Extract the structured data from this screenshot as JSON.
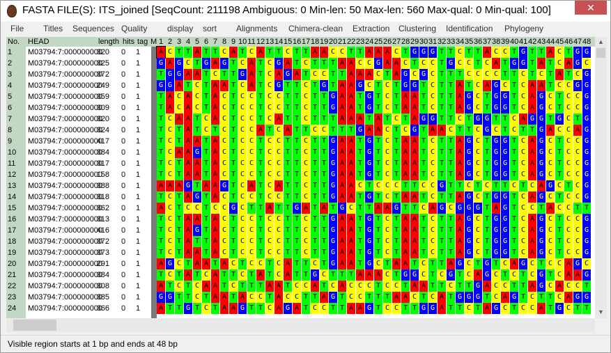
{
  "window": {
    "title": "FASTA FILE(S): ITS_joined [SeqCount: 211198 Ambiguous: 0 Min-len: 50 Max-len: 560 Max-qual: 0 Min-qual: 100]"
  },
  "menu": [
    "File",
    "Titles",
    "Sequences",
    "Quality",
    "display",
    "sort",
    "Alignments",
    "Chimera-clean",
    "Extraction",
    "Clustering",
    "Identification",
    "Phylogeny"
  ],
  "columns": {
    "no": "No.",
    "head": "HEAD",
    "length": "length",
    "hits": "hits",
    "tag": "tag",
    "m": "M"
  },
  "positions": [
    "1",
    "2",
    "3",
    "4",
    "5",
    "6",
    "7",
    "8",
    "9",
    "10",
    "11",
    "12",
    "13",
    "14",
    "15",
    "16",
    "17",
    "18",
    "19",
    "20",
    "21",
    "22",
    "23",
    "24",
    "25",
    "26",
    "27",
    "28",
    "29",
    "30",
    "31",
    "32",
    "33",
    "34",
    "35",
    "36",
    "37",
    "38",
    "39",
    "40",
    "41",
    "42",
    "43",
    "44",
    "45",
    "46",
    "47",
    "48"
  ],
  "rows": [
    {
      "no": "1",
      "head": "M03794:7:000000000",
      "length": "320",
      "hits": "0",
      "tag": "1",
      "seq": "ACTTATTCATCATTCTTAACCTTAAACTGGGTTCTTACCTGTTACTGG"
    },
    {
      "no": "2",
      "head": "M03794:7:000000000",
      "length": "325",
      "hits": "0",
      "tag": "1",
      "seq": "GAGCTGAGTCATCGATCTTTAACCGAACTCCTGCCTCATGGTATCAGC"
    },
    {
      "no": "3",
      "head": "M03794:7:000000000",
      "length": "372",
      "hits": "0",
      "tag": "1",
      "seq": "TGGAATCTTGATCAGATCCTTAAACTAGCGCTTTCCCCTTCTCTATCG"
    },
    {
      "no": "4",
      "head": "M03794:7:000000000",
      "length": "249",
      "hits": "0",
      "tag": "1",
      "seq": "GGATCTAATCATCGTTCTGTAAGCTCTGGTCTTATCAGCTCAATCCGG"
    },
    {
      "no": "5",
      "head": "M03794:7:000000000",
      "length": "359",
      "hits": "0",
      "tag": "1",
      "seq": "TACACTACTCCTCCTTCTTGAATGTCTAATCTTAGCTGGTCAGCTCCG"
    },
    {
      "no": "6",
      "head": "M03794:7:000000000",
      "length": "309",
      "hits": "0",
      "tag": "1",
      "seq": "TACACTACTCCTCCTTCTTGAATGTCTAATCTTAGCTGGTCAGCTCCG"
    },
    {
      "no": "7",
      "head": "M03794:7:000000000",
      "length": "320",
      "hits": "0",
      "tag": "1",
      "seq": "TCAATCACTCCTCATTCTTTAAATATCTAGGTTCTGGTTCAGGTGCTG"
    },
    {
      "no": "8",
      "head": "M03794:7:000000000",
      "length": "324",
      "hits": "0",
      "tag": "1",
      "seq": "TCTATCTCTCCATCATTCCTTTGAACTCGTAACTTCGCTCTTGACCAG"
    },
    {
      "no": "9",
      "head": "M03794:7:000000000",
      "length": "417",
      "hits": "0",
      "tag": "1",
      "seq": "TCTAATACTCCTCCTTCTTGAATGTCTAATCTTAGCTGGTCAGCTCCG"
    },
    {
      "no": "10",
      "head": "M03794:7:000000000",
      "length": "384",
      "hits": "0",
      "tag": "1",
      "seq": "TCAAGTACTCCTCCTTCTTGAATGTCTAATCTTAGCTGGTCAGCTCCG"
    },
    {
      "no": "11",
      "head": "M03794:7:000000000",
      "length": "317",
      "hits": "0",
      "tag": "1",
      "seq": "TCTAATACTCCTCCTTCTTGAATGTCTAATCTTAGCTGGTCAGCTCCG"
    },
    {
      "no": "12",
      "head": "M03794:7:000000000",
      "length": "158",
      "hits": "0",
      "tag": "1",
      "seq": "TCTAATACTCCTCCTTCTTGAATGTCTAATCTTAGCTGGTCAGCTCCG"
    },
    {
      "no": "13",
      "head": "M03794:7:000000000",
      "length": "388",
      "hits": "0",
      "tag": "1",
      "seq": "AAAGTAAGTCATCATTCTTGAACTCCCTTCCGTTCTCTTCTCAGCTCG"
    },
    {
      "no": "14",
      "head": "M03794:7:000000000",
      "length": "318",
      "hits": "0",
      "tag": "1",
      "seq": "TCTAGTACTCCTCCTTCTTGAATGTCTAATCTTAGCTGGTCAGCTCCG"
    },
    {
      "no": "15",
      "head": "M03794:7:000000000",
      "length": "362",
      "hits": "0",
      "tag": "1",
      "seq": "ACTCCTCCGCTTATTGATATGCTTAAGTTCAGCGGGTAGTCCTACCTT"
    },
    {
      "no": "16",
      "head": "M03794:7:000000000",
      "length": "313",
      "hits": "0",
      "tag": "1",
      "seq": "TCTAATACTCCTCCTTCTTGAATGTCTAATCTTAGCTGGTCAGCTCCG"
    },
    {
      "no": "17",
      "head": "M03794:7:000000000",
      "length": "416",
      "hits": "0",
      "tag": "1",
      "seq": "TCTAGTACTCCTCCTTCTTGAATGTCTAATCTTAGCTGGTCAGCTCCG"
    },
    {
      "no": "18",
      "head": "M03794:7:000000000",
      "length": "372",
      "hits": "0",
      "tag": "1",
      "seq": "TCTATTACTCCTCCTTCTTGAATGTCTAATCTTAGCTGGTCAGCTCCG"
    },
    {
      "no": "19",
      "head": "M03794:7:000000000",
      "length": "373",
      "hits": "0",
      "tag": "1",
      "seq": "TCTAATACTCCTCCTTCTTGAATGTCTAATCTTAGCTGGTCAGCTCCG"
    },
    {
      "no": "20",
      "head": "M03794:7:000000000",
      "length": "291",
      "hits": "0",
      "tag": "1",
      "seq": "AGCTAATACTCCTCATTCTGAATGCTAATCTTAGCTGTCAGCTCCAGC"
    },
    {
      "no": "21",
      "head": "M03794:7:000000000",
      "length": "384",
      "hits": "0",
      "tag": "1",
      "seq": "TCTATCATTCTATCATTGCTTTAAACTGGCTCGTCAGCTCTCGTCAAG"
    },
    {
      "no": "22",
      "head": "M03794:7:000000000",
      "length": "308",
      "hits": "0",
      "tag": "1",
      "seq": "ATCTCAATCTTTAATCCATCACCCTCCTAATTCTTGACCTTAGCACCT"
    },
    {
      "no": "23",
      "head": "M03794:7:000000000",
      "length": "385",
      "hits": "0",
      "tag": "1",
      "seq": "GGTTCTAATACCTACCTTAGTCCTTTAACTCATGGGTCAGTCTTCAGG"
    },
    {
      "no": "24",
      "head": "M03794:7:000000000",
      "length": "366",
      "hits": "0",
      "tag": "1",
      "seq": "ATTGTCTAAGTTCAGATCCTTAAGTCCTTGGATTCTAGCTCCATGCTT"
    }
  ],
  "nucleotide_colors": {
    "A": "#ff0000",
    "C": "#ffff00",
    "G": "#0000ff",
    "T": "#00ff00"
  },
  "status": "Visible region starts at 1 bp and ends at 48 bp"
}
